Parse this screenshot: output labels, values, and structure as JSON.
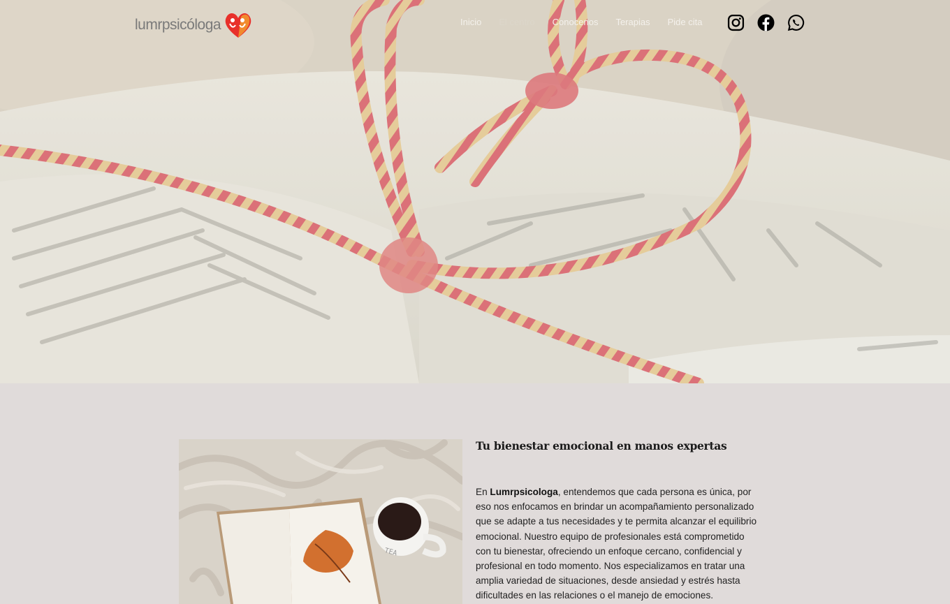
{
  "header": {
    "logo_text": "lumrpsicóloga",
    "nav": [
      {
        "label": "Inicio",
        "active": false
      },
      {
        "label": "El centro",
        "active": true
      },
      {
        "label": "Conocenos",
        "active": false
      },
      {
        "label": "Terapias",
        "active": false
      },
      {
        "label": "Pide cita",
        "active": false
      }
    ],
    "social": [
      "instagram-icon",
      "facebook-icon",
      "whatsapp-icon"
    ]
  },
  "colors": {
    "page_bg": "#e0dbda",
    "logo_red": "#e8302a",
    "logo_orange": "#f29a2e",
    "rope_red": "#d9616a",
    "rope_tan": "#e6c98e"
  },
  "section": {
    "title": "Tu bienestar emocional en manos expertas",
    "intro_prefix": "En ",
    "brand": "Lumrpsicologa",
    "body": ", entendemos que cada persona es única, por eso nos enfocamos en brindar un acompañamiento personalizado que se adapte a tus necesidades y te permita alcanzar el equilibrio emocional. Nuestro equipo de profesionales está comprometido con tu bienestar, ofreciendo un enfoque cercano, confidencial y profesional en todo momento. Nos especializamos en tratar una amplia variedad de situaciones, desde ansiedad y estrés hasta dificultades en las relaciones o el manejo de emociones."
  }
}
